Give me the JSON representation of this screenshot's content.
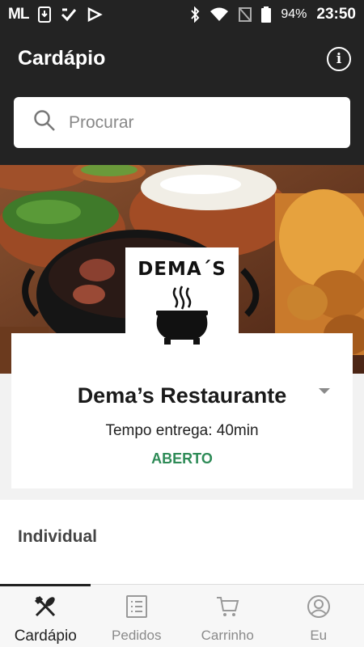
{
  "status_bar": {
    "carrier": "ML",
    "battery": "94%",
    "time": "23:50"
  },
  "header": {
    "title": "Cardápio"
  },
  "search": {
    "placeholder": "Procurar"
  },
  "restaurant": {
    "logo_text": "DEMA´S",
    "name": "Dema’s Restaurante",
    "delivery_time": "Tempo entrega: 40min",
    "status": "ABERTO",
    "status_color": "#2e8b57"
  },
  "section": {
    "title": "Individual"
  },
  "bottom_nav": {
    "items": [
      {
        "label": "Cardápio",
        "icon": "fork-knife-icon",
        "active": true
      },
      {
        "label": "Pedidos",
        "icon": "list-icon",
        "active": false
      },
      {
        "label": "Carrinho",
        "icon": "cart-icon",
        "active": false
      },
      {
        "label": "Eu",
        "icon": "user-icon",
        "active": false
      }
    ]
  },
  "colors": {
    "header_bg": "#232323",
    "accent": "#2e8b57"
  }
}
